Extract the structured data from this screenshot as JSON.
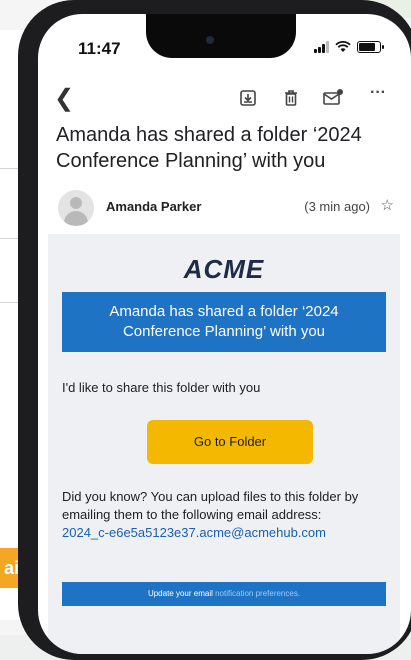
{
  "background": {
    "cta_fragment": "ai"
  },
  "status_bar": {
    "time": "11:47"
  },
  "toolbar": {
    "back_icon": "chevron-left-icon",
    "icons": [
      "archive-icon",
      "trash-icon",
      "mark-unread-icon",
      "more-icon"
    ]
  },
  "email": {
    "subject": "Amanda has shared a folder ‘2024 Conference Planning’ with you",
    "sender_name": "Amanda Parker",
    "time_ago": "(3 min ago)"
  },
  "body": {
    "logo": "ACME",
    "banner": "Amanda has shared a folder ‘2024 Conference Planning’ with you",
    "intro": "I'd like to share this folder with  you",
    "cta_label": "Go to Folder",
    "info_text": "Did you know? You can upload files to this folder by emailing them to the following email address:",
    "email_address": "2024_c-e6e5a5123e37.acme@acmehub.com",
    "footer_text": "Update your email",
    "footer_link": "notification preferences."
  },
  "colors": {
    "banner": "#1f73c4",
    "cta": "#f5b800",
    "link": "#1a5fb4",
    "bg_cta": "#f5a623"
  }
}
